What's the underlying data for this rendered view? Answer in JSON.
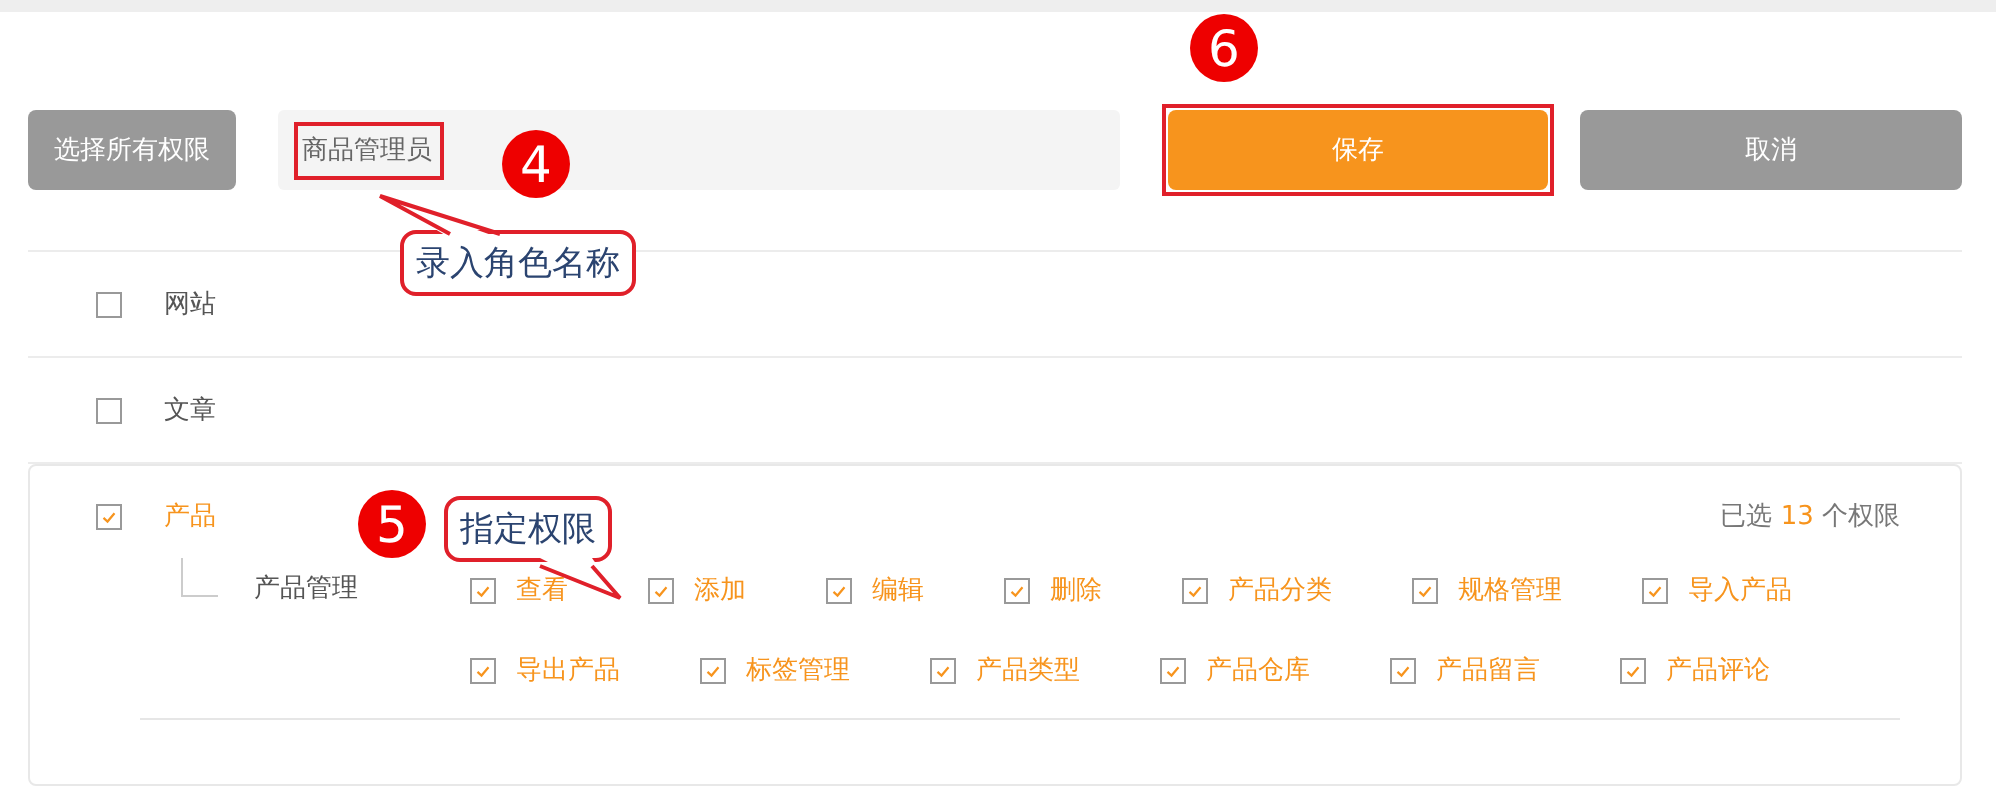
{
  "toolbar": {
    "select_all_button": "选择所有权限",
    "role_name_field": {
      "value": "商品管理员"
    },
    "save_button": "保存",
    "cancel_button": "取消"
  },
  "groups": [
    {
      "name": "网站",
      "checked": false
    },
    {
      "name": "文章",
      "checked": false
    },
    {
      "name": "产品",
      "checked": true,
      "selected_count": {
        "prefix": "已选",
        "count": "13",
        "suffix": "个权限"
      },
      "children": [
        {
          "name": "产品管理",
          "permissions": [
            {
              "label": "查看",
              "checked": true
            },
            {
              "label": "添加",
              "checked": true
            },
            {
              "label": "编辑",
              "checked": true
            },
            {
              "label": "删除",
              "checked": true
            },
            {
              "label": "产品分类",
              "checked": true
            },
            {
              "label": "规格管理",
              "checked": true
            },
            {
              "label": "导入产品",
              "checked": true
            },
            {
              "label": "导出产品",
              "checked": true
            },
            {
              "label": "标签管理",
              "checked": true
            },
            {
              "label": "产品类型",
              "checked": true
            },
            {
              "label": "产品仓库",
              "checked": true
            },
            {
              "label": "产品留言",
              "checked": true
            },
            {
              "label": "产品评论",
              "checked": true
            }
          ]
        }
      ]
    }
  ],
  "annotations": [
    {
      "number": "4",
      "callout": "录入角色名称"
    },
    {
      "number": "5",
      "callout": "指定权限"
    },
    {
      "number": "6"
    }
  ]
}
